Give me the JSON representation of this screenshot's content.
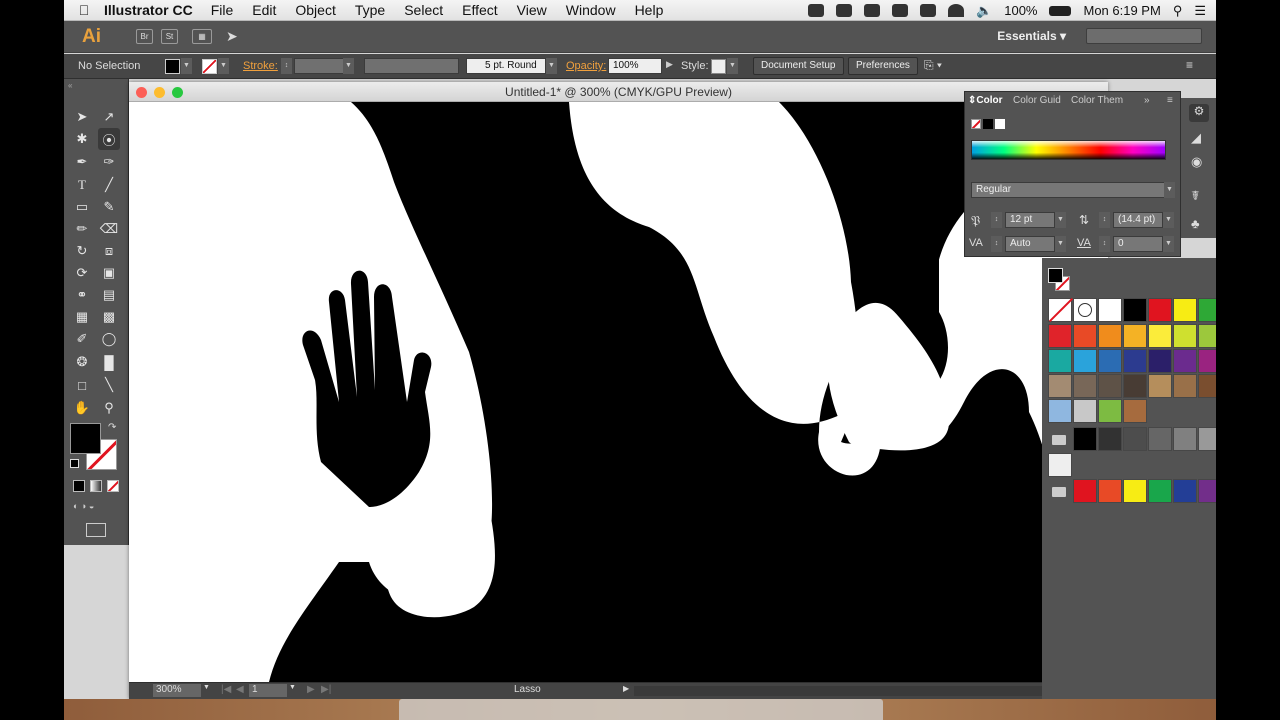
{
  "menubar": {
    "app": "Illustrator CC",
    "items": [
      "File",
      "Edit",
      "Object",
      "Type",
      "Select",
      "Effect",
      "View",
      "Window",
      "Help"
    ],
    "battery": "100%",
    "clock": "Mon 6:19 PM"
  },
  "appbar": {
    "logo": "Ai",
    "br": "Br",
    "st": "St",
    "workspace": "Essentials"
  },
  "control": {
    "selection": "No Selection",
    "stroke_label": "Stroke:",
    "brush": "5 pt. Round",
    "opacity_label": "Opacity:",
    "opacity_value": "100%",
    "style_label": "Style:",
    "document_setup": "Document Setup",
    "preferences": "Preferences"
  },
  "document": {
    "title": "Untitled-1* @ 300% (CMYK/GPU Preview)",
    "zoom": "300%",
    "artboard": "1",
    "status_tool": "Lasso"
  },
  "color_panel": {
    "tabs": [
      "Color",
      "Color Guid",
      "Color Them"
    ],
    "font_style": "Regular",
    "font_size": "12 pt",
    "leading": "(14.4 pt)",
    "kerning": "Auto",
    "tracking": "0"
  },
  "colors": {
    "accent": "#f0a03d",
    "panel": "#535353",
    "fill": "#000000"
  },
  "swatch_rows": [
    [
      "#ffffff",
      "#000000",
      "#e0141f",
      "#f7ec14",
      "#2ea836"
    ],
    [
      "#e0232a",
      "#e84a26",
      "#f08c1c",
      "#f4b225",
      "#fbec3a",
      "#cfe02f",
      "#9cc83c"
    ],
    [
      "#1aa9a1",
      "#2aa3db",
      "#2b6cb3",
      "#2c3b8f",
      "#2b1f69",
      "#6b2b8e",
      "#9a2380"
    ],
    [
      "#a38b72",
      "#786758",
      "#5e5247",
      "#483c34",
      "#b58e5c",
      "#997049",
      "#7a4e2f"
    ],
    [
      "#000000",
      "#323232",
      "#4d4d4d",
      "#666666",
      "#808080",
      "#999999"
    ],
    [
      "#e0141f",
      "#e84a26",
      "#f7ec14",
      "#19a64b",
      "#233e96",
      "#722e8a"
    ]
  ]
}
